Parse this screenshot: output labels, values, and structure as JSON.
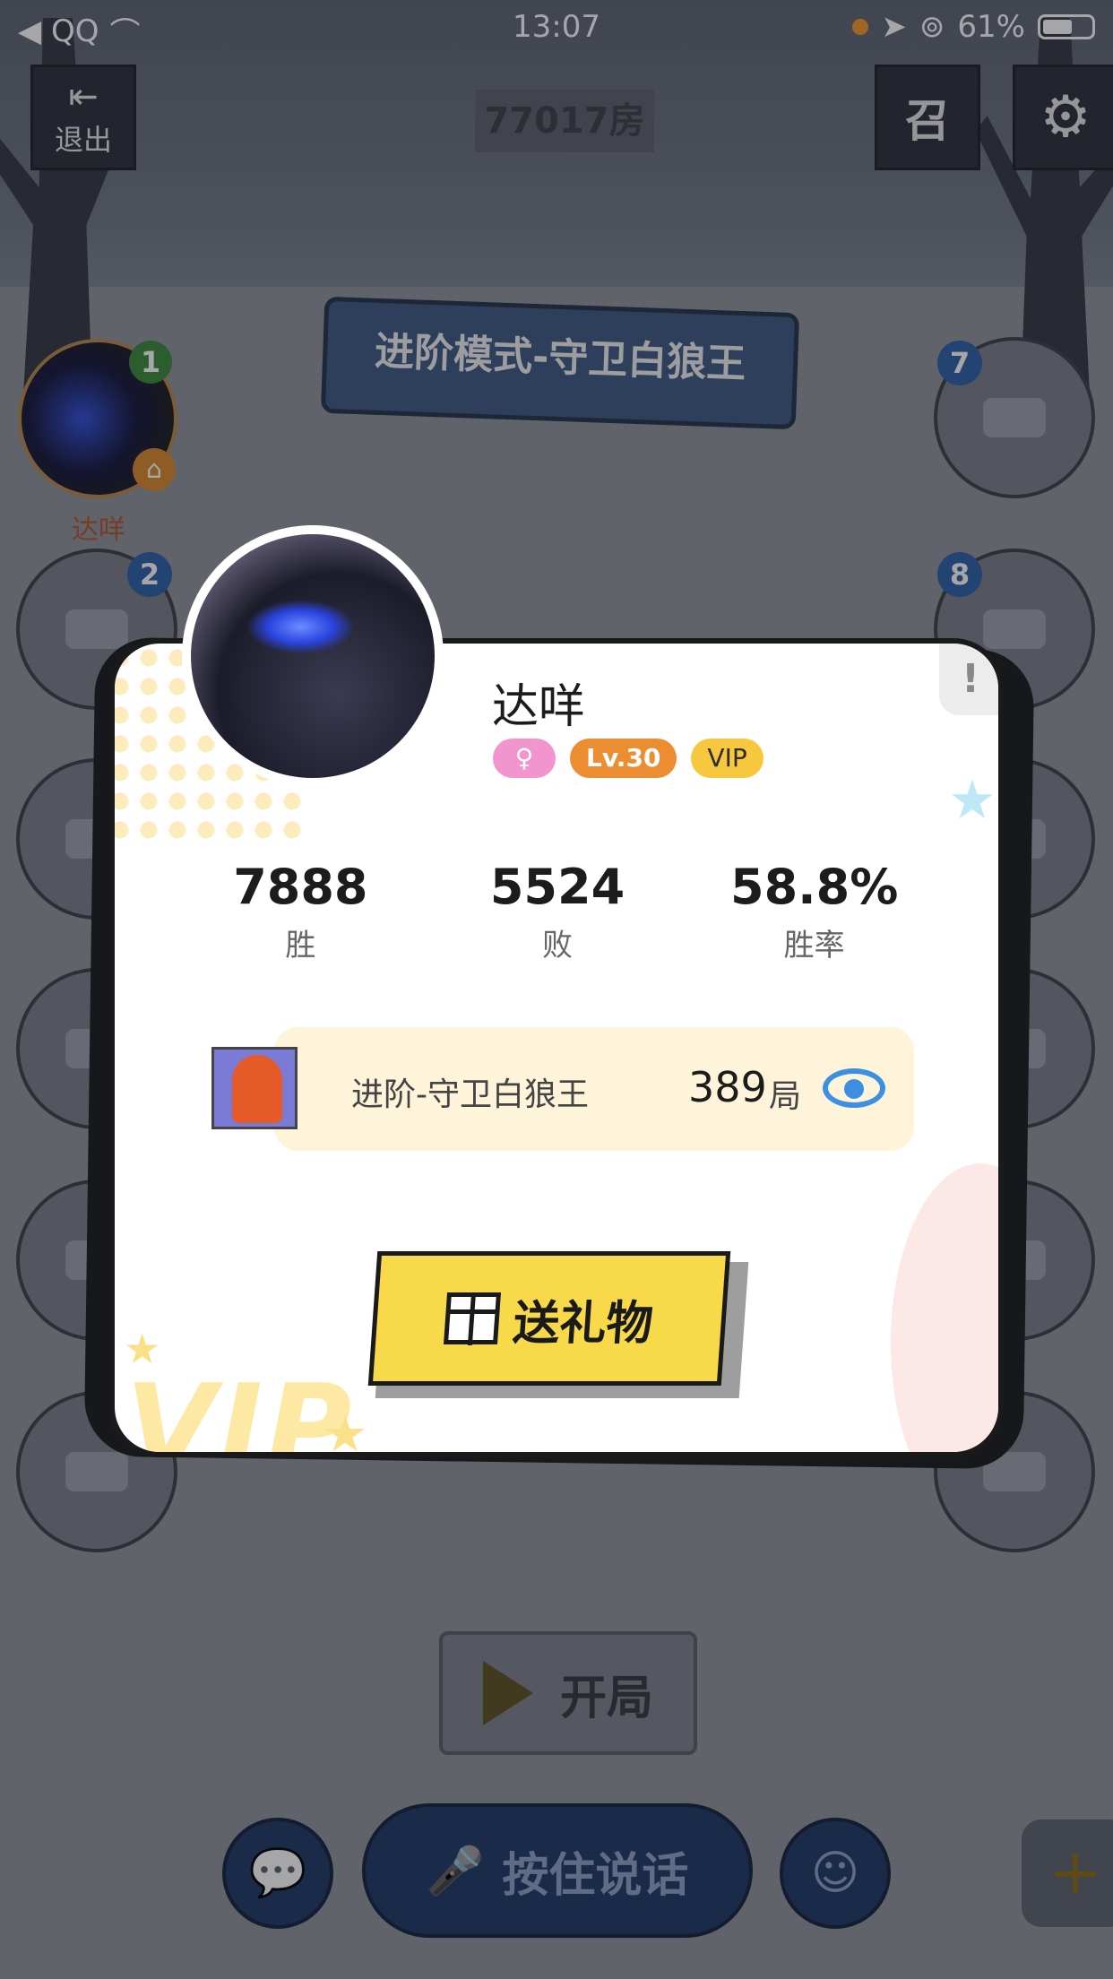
{
  "status_bar": {
    "back_app": "◀ QQ",
    "time": "13:07",
    "battery_percent": "61%",
    "battery_level": 0.61
  },
  "room": {
    "exit_label": "退出",
    "room_number": "77017房",
    "summon_label": "召",
    "mode_banner": "进阶模式-守卫白狼王"
  },
  "seats": {
    "host": {
      "number": "1",
      "name": "达咩"
    },
    "numbers_visible": [
      "2",
      "7",
      "8"
    ]
  },
  "controls": {
    "start_label": "开局",
    "talk_label": "按住说话"
  },
  "profile_card": {
    "nickname": "达咩",
    "badges": {
      "gender": "♀",
      "level": "Lv.30",
      "vip": "VIP"
    },
    "stats": [
      {
        "value": "7888",
        "label": "胜"
      },
      {
        "value": "5524",
        "label": "败"
      },
      {
        "value": "58.8%",
        "label": "胜率"
      }
    ],
    "mode_record": {
      "mode_name": "进阶-守卫白狼王",
      "count": "389",
      "unit": "局"
    },
    "gift_button_label": "送礼物",
    "report_label": "!",
    "decor_vip_text": "VIP"
  },
  "colors": {
    "gift_button": "#f8d94a",
    "level_badge": "#ec8d32",
    "vip_badge": "#f7c83d",
    "gender_badge": "#f295cf",
    "eye_icon": "#3d8fe2"
  }
}
